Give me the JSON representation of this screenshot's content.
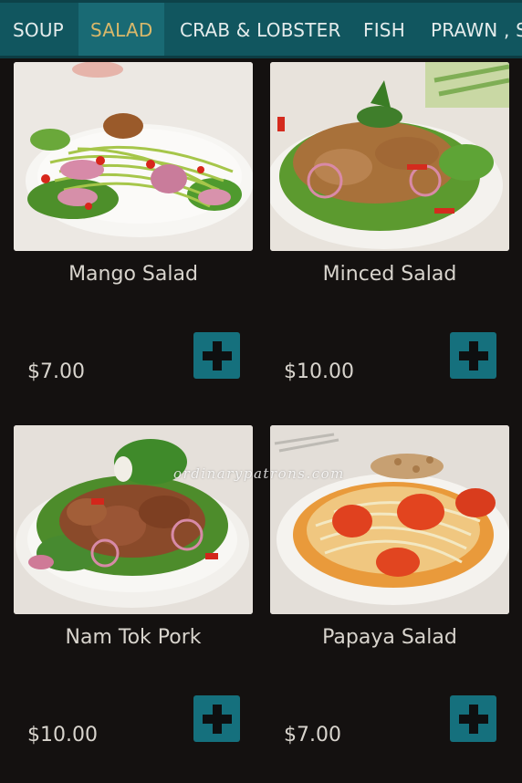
{
  "tabs": [
    {
      "label": "SOUP",
      "active": false
    },
    {
      "label": "SALAD",
      "active": true
    },
    {
      "label": "CRAB & LOBSTER",
      "active": false
    },
    {
      "label": "FISH",
      "active": false
    },
    {
      "label": "PRAWN , S",
      "active": false
    }
  ],
  "colors": {
    "tab_bar": "#11565f",
    "tab_active_bg": "#196a74",
    "tab_active_text": "#d9b86a",
    "add_button": "#15707d",
    "background": "#141110"
  },
  "items": [
    {
      "name": "Mango Salad",
      "price": "$7.00",
      "photo": "mango-salad-photo",
      "add_icon": "plus-icon"
    },
    {
      "name": "Minced Salad",
      "price": "$10.00",
      "photo": "minced-salad-photo",
      "add_icon": "plus-icon"
    },
    {
      "name": "Nam Tok Pork",
      "price": "$10.00",
      "photo": "nam-tok-pork-photo",
      "add_icon": "plus-icon"
    },
    {
      "name": "Papaya Salad",
      "price": "$7.00",
      "photo": "papaya-salad-photo",
      "add_icon": "plus-icon"
    }
  ],
  "watermark": "ordinarypatrons.com"
}
